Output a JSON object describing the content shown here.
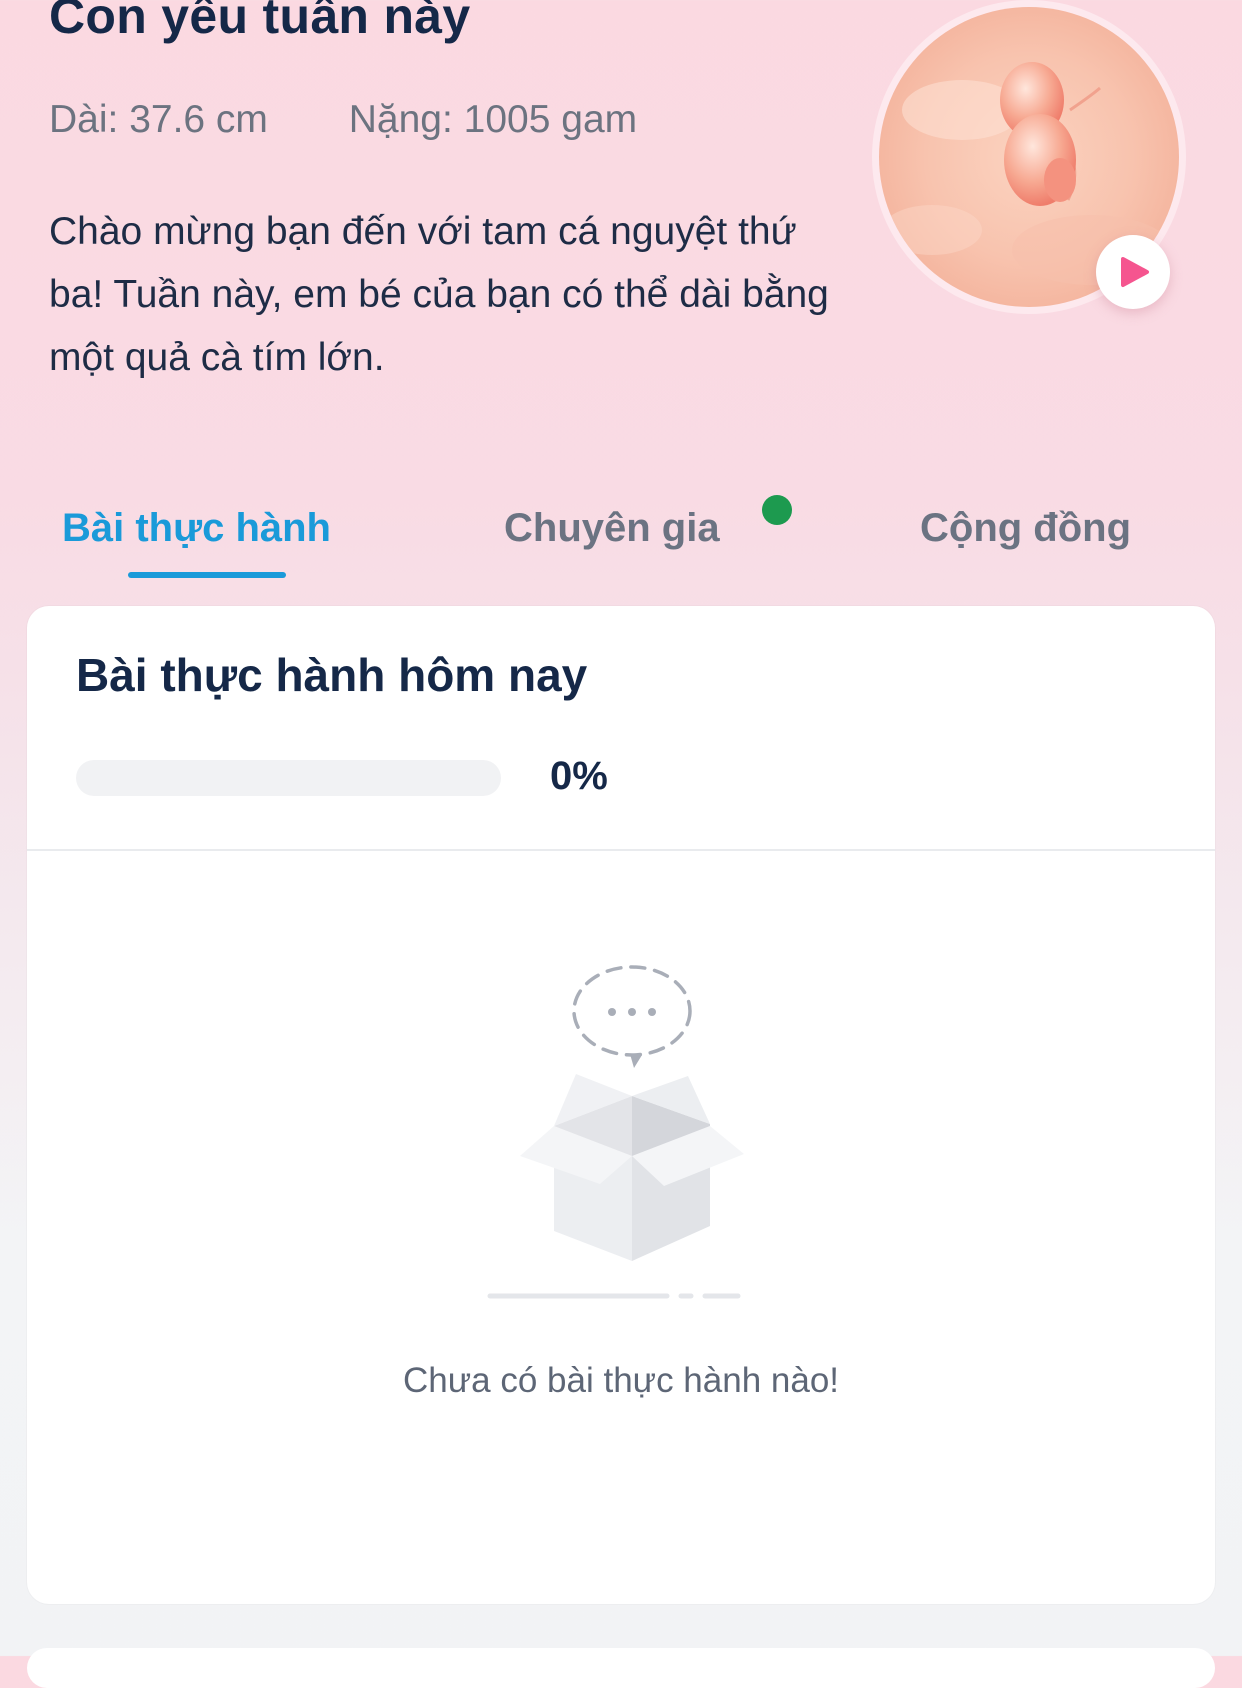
{
  "header": {
    "title": "Con yêu tuần này",
    "length": "Dài: 37.6 cm",
    "weight": "Nặng: 1005 gam",
    "description": "Chào mừng bạn đến với tam cá nguyệt thứ ba!  Tuần này, em bé của bạn có thể dài bằng một quả cà tím lớn."
  },
  "media": {
    "image": "fetus-illustration",
    "play_icon": "play-icon"
  },
  "tabs": [
    {
      "label": "Bài thực hành",
      "active": true
    },
    {
      "label": "Chuyên gia",
      "active": false,
      "has_notification": true
    },
    {
      "label": "Cộng đồng",
      "active": false
    }
  ],
  "practice": {
    "title": "Bài thực hành hôm nay",
    "progress": 0,
    "progress_label": "0%",
    "empty_text": "Chưa có bài thực hành nào!",
    "empty_icon": "empty-box-icon"
  },
  "colors": {
    "accent": "#1a9ad9",
    "title": "#152848",
    "notification_dot": "#1d9a4f",
    "play": "#f5558f"
  }
}
